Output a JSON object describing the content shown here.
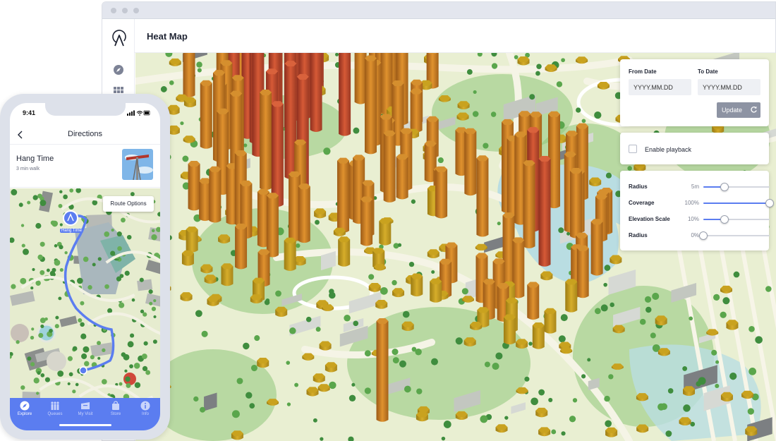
{
  "app": {
    "title": "Heat Map"
  },
  "sidebar": {
    "icons": [
      "app-logo-icon",
      "compass-icon",
      "grid-icon"
    ]
  },
  "filters": {
    "from_label": "From Date",
    "to_label": "To Date",
    "from_placeholder": "YYYY.MM.DD",
    "to_placeholder": "YYYY.MM.DD",
    "update_label": "Update"
  },
  "playback": {
    "label": "Enable playback",
    "checked": false
  },
  "sliders": [
    {
      "name": "Radius",
      "value": "5m",
      "fraction": 0.32
    },
    {
      "name": "Coverage",
      "value": "100%",
      "fraction": 1.0
    },
    {
      "name": "Elevation Scale",
      "value": "10%",
      "fraction": 0.32
    },
    {
      "name": "Radius",
      "value": "0%",
      "fraction": 0.0
    }
  ],
  "phone": {
    "time": "9:41",
    "header_title": "Directions",
    "ride_name": "Hang Time",
    "ride_walk": "3 min walk",
    "pin_label": "Hang Time",
    "route_options_label": "Route Options",
    "tabs": [
      {
        "label": "Explore",
        "icon": "compass-icon",
        "active": true
      },
      {
        "label": "Queues",
        "icon": "people-icon",
        "active": false
      },
      {
        "label": "My Visit",
        "icon": "ticket-icon",
        "active": false
      },
      {
        "label": "Store",
        "icon": "bag-icon",
        "active": false
      },
      {
        "label": "Info",
        "icon": "info-icon",
        "active": false
      }
    ]
  },
  "colors": {
    "accent": "#5b7df0",
    "update_button": "#8d93a3",
    "column_low": "#c9a21f",
    "column_high": "#c04a2c",
    "park_green": "#8fc77a",
    "water": "#b9dde2"
  }
}
